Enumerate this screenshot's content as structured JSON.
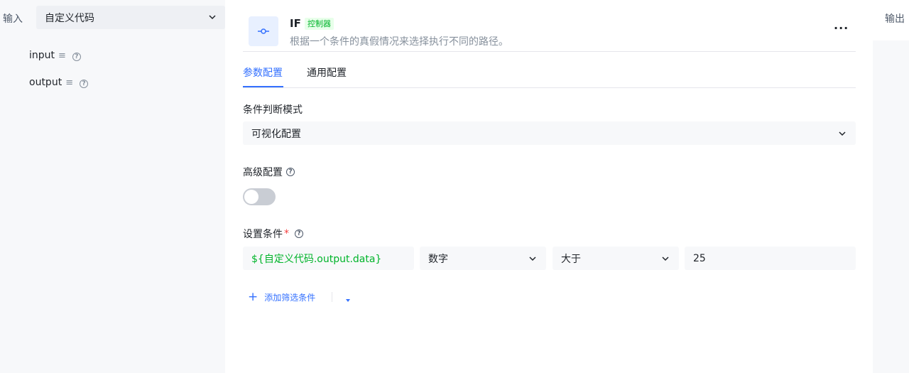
{
  "left_panel": {
    "input_label": "输入",
    "source_select_value": "自定义代码",
    "variables": [
      {
        "name": "input"
      },
      {
        "name": "output"
      }
    ]
  },
  "right_panel": {
    "output_label": "输出"
  },
  "node": {
    "title": "IF",
    "tag": "控制器",
    "description": "根据一个条件的真假情况来选择执行不同的路径。",
    "icon": "branch-icon",
    "more_label": "···"
  },
  "tabs": [
    {
      "label": "参数配置",
      "active": true
    },
    {
      "label": "通用配置",
      "active": false
    }
  ],
  "condition_mode": {
    "label": "条件判断模式",
    "value": "可视化配置"
  },
  "advanced": {
    "label": "高级配置",
    "enabled": false
  },
  "conditions": {
    "label": "设置条件",
    "required_mark": "*",
    "rows": [
      {
        "expression": "${自定义代码.output.data}",
        "type": "数字",
        "operator": "大于",
        "value": "25"
      }
    ],
    "add_label": "添加筛选条件"
  },
  "colors": {
    "accent": "#3370ff",
    "tag_green": "#00b42a",
    "panel_bg": "#f7f8fa",
    "required": "#f53f3f"
  }
}
